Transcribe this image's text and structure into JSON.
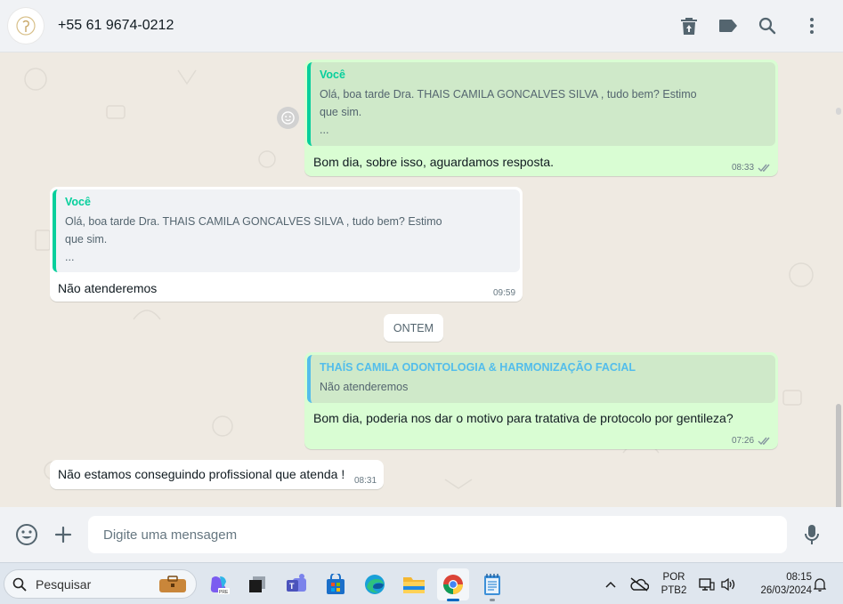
{
  "header": {
    "contact": "+55 61 9674-0212",
    "icons": [
      "delete-icon",
      "label-icon",
      "search-icon",
      "menu-icon"
    ]
  },
  "messages": [
    {
      "direction": "outgoing",
      "quote_author": "Você",
      "quote_text": "Olá, boa tarde Dra. THAIS CAMILA GONCALVES SILVA , tudo bem? Estimo\nque sim.\n...",
      "text": "Bom dia, sobre isso, aguardamos resposta.",
      "time": "08:33"
    },
    {
      "direction": "incoming",
      "quote_author": "Você",
      "quote_text": "Olá, boa tarde Dra. THAIS CAMILA GONCALVES SILVA , tudo bem? Estimo\nque sim.\n...",
      "text": "Não atenderemos",
      "time": "09:59"
    },
    {
      "direction": "outgoing",
      "quote_author": "THAÍS CAMILA ODONTOLOGIA & HARMONIZAÇÃO FACIAL",
      "quote_text": "Não atenderemos",
      "text": "Bom dia, poderia nos dar o motivo para tratativa de protocolo por gentileza?",
      "time": "07:26"
    },
    {
      "direction": "incoming",
      "text": "Não estamos conseguindo profissional que atenda !",
      "time": "08:31"
    }
  ],
  "date_divider": "ONTEM",
  "composer": {
    "placeholder": "Digite uma mensagem"
  },
  "taskbar": {
    "search_placeholder": "Pesquisar",
    "language": "POR",
    "layout": "PTB2",
    "time": "08:15",
    "date": "26/03/2024"
  },
  "colors": {
    "outgoing_bubble": "#d9fdd3",
    "incoming_bubble": "#ffffff",
    "you_accent": "#06cf9c",
    "contact_accent": "#53bdeb"
  }
}
